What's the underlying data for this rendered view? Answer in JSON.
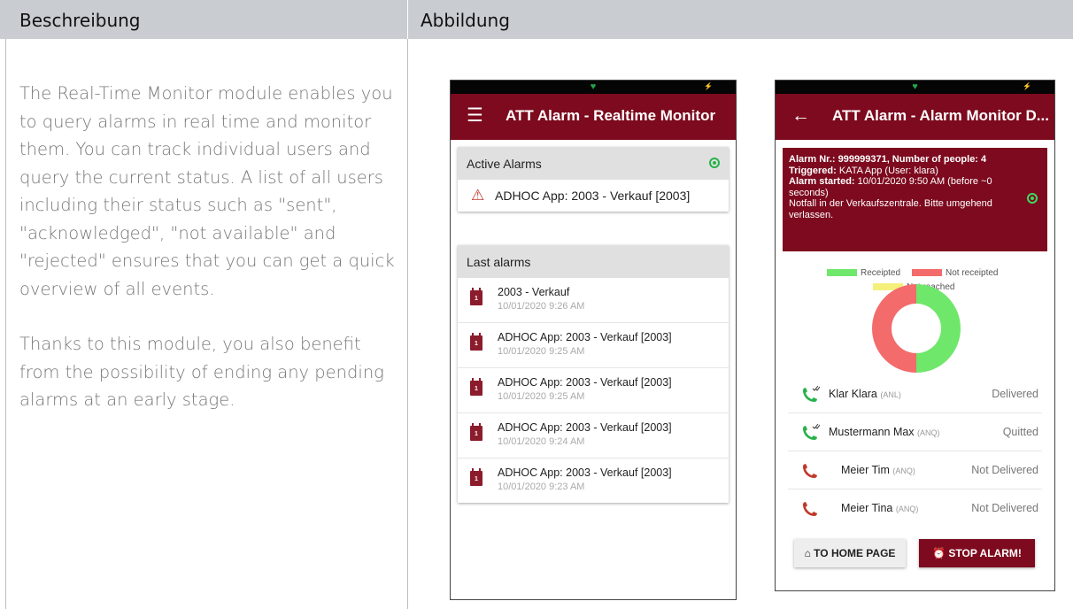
{
  "table": {
    "col_description": "Beschreibung",
    "col_figure": "Abbildung"
  },
  "description": {
    "paragraph1": "The Real-Time Monitor module enables you to query alarms in real time and monitor them. You can track individual users and query the current status. A list of all users including their status such as \"sent\", \"acknowledged\", \"not available\" and \"rejected\" ensures that you can get a quick overview of all events.",
    "paragraph2": "Thanks to this module, you also benefit from the possibility of ending any pending alarms at an early stage."
  },
  "phone1": {
    "app_title": "ATT Alarm - Realtime Monitor",
    "menu_icon": "hamburger-menu-icon",
    "active_alarms_label": "Active Alarms",
    "active_alarm_text": "ADHOC App: 2003 - Verkauf [2003]",
    "last_alarms_label": "Last alarms",
    "calendar_day": "1",
    "last_alarms": [
      {
        "title": "2003 - Verkauf",
        "time": "10/01/2020 9:26 AM"
      },
      {
        "title": "ADHOC App: 2003 - Verkauf [2003]",
        "time": "10/01/2020 9:25 AM"
      },
      {
        "title": "ADHOC App: 2003 - Verkauf [2003]",
        "time": "10/01/2020 9:25 AM"
      },
      {
        "title": "ADHOC App: 2003 - Verkauf [2003]",
        "time": "10/01/2020 9:24 AM"
      },
      {
        "title": "ADHOC App: 2003 - Verkauf [2003]",
        "time": "10/01/2020 9:23 AM"
      }
    ]
  },
  "phone2": {
    "app_title": "ATT Alarm - Alarm Monitor D...",
    "back_icon": "back-arrow-icon",
    "info": {
      "line1": "Alarm Nr.: 999999371, Number of people: 4",
      "triggered_label": "Triggered:",
      "triggered_value": " KATA App (User: klara)",
      "started_label": "Alarm started:",
      "started_value": " 10/01/2020 9:50 AM (before ~0 seconds)",
      "message": "Notfall in der Verkaufszentrale. Bitte umgehend verlassen."
    },
    "legend": {
      "receipted": "Receipted",
      "not_receipted": "Not receipted",
      "not_reached": "Not reached"
    },
    "colors": {
      "receipted": "#6ee76b",
      "not_receipted": "#f36b6b",
      "not_reached": "#f4f07a",
      "brand": "#7d0a1e"
    },
    "chart_data": {
      "type": "pie",
      "labels": [
        "Receipted",
        "Not receipted",
        "Not reached"
      ],
      "values": [
        2,
        2,
        0
      ]
    },
    "contacts": [
      {
        "name": "Klar Klara",
        "code": "(ANL)",
        "status": "Delivered",
        "icon": "phone-check-icon"
      },
      {
        "name": "Mustermann Max",
        "code": "(ANQ)",
        "status": "Quitted",
        "icon": "phone-check-icon"
      },
      {
        "name": "Meier Tim",
        "code": "(ANQ)",
        "status": "Not Delivered",
        "icon": "phone-icon"
      },
      {
        "name": "Meier Tina",
        "code": "(ANQ)",
        "status": "Not Delivered",
        "icon": "phone-icon"
      }
    ],
    "home_button": "TO HOME PAGE",
    "stop_button": "STOP ALARM!"
  }
}
